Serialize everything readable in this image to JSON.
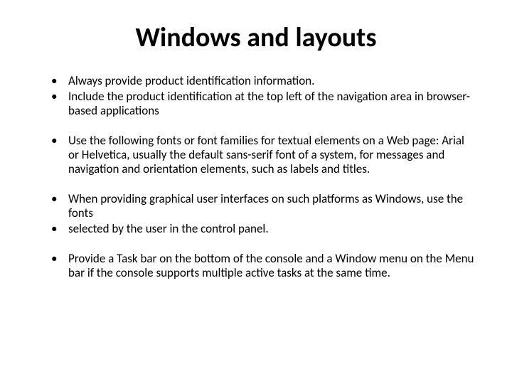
{
  "title": "Windows and layouts",
  "bullets": [
    {
      "text": "Always provide product identification information.",
      "spaced": false
    },
    {
      "text": "Include the product identification at the top left of the navigation area in browser-based applications",
      "spaced": false
    },
    {
      "text": "Use the following fonts or font families for textual elements on a Web page:  Arial or Helvetica, usually the default sans-serif font of a system, for messages and navigation and orientation elements, such as labels and titles.",
      "spaced": true
    },
    {
      "text": "When providing graphical user interfaces on such platforms as Windows, use the fonts",
      "spaced": true
    },
    {
      "text": "selected by the user in the control panel.",
      "spaced": false
    },
    {
      "text": "Provide a Task bar on the bottom of the console and a Window menu on the Menu bar if the console supports multiple active tasks at the same time.",
      "spaced": true
    }
  ]
}
